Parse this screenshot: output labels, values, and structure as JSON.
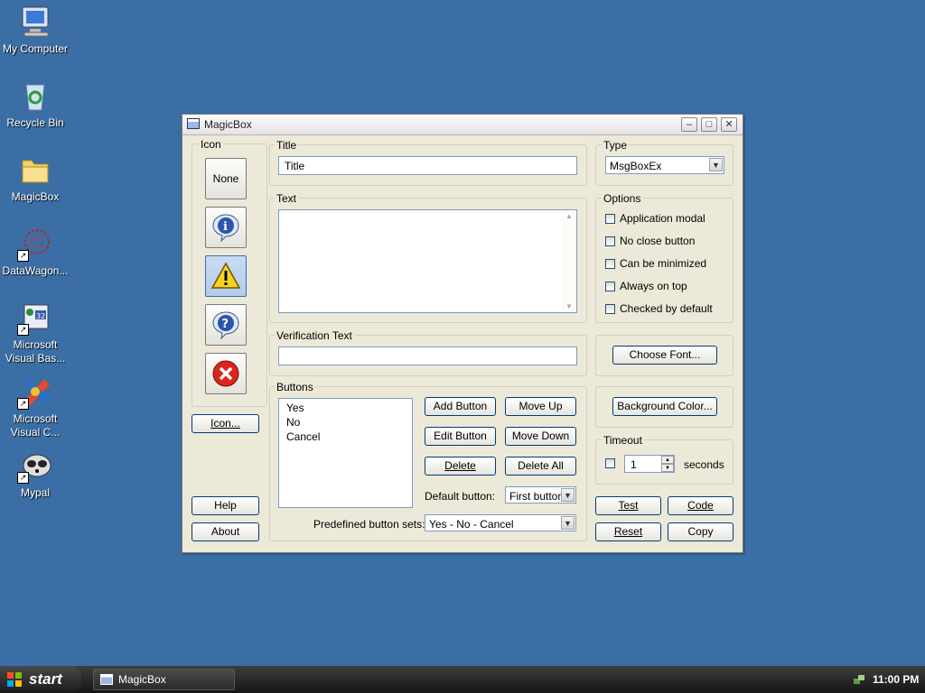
{
  "desktop": {
    "icons": [
      {
        "label": "My Computer",
        "icon": "computer-icon"
      },
      {
        "label": "Recycle Bin",
        "icon": "recycle-bin-icon"
      },
      {
        "label": "MagicBox",
        "icon": "folder-icon"
      },
      {
        "label": "DataWagon...",
        "icon": "datawagon-icon"
      },
      {
        "label": "Microsoft Visual Bas...",
        "icon": "visual-basic-icon"
      },
      {
        "label": "Microsoft Visual C...",
        "icon": "visual-c-icon"
      },
      {
        "label": "Mypal",
        "icon": "mypal-icon"
      }
    ]
  },
  "window": {
    "title": "MagicBox",
    "icon_group": {
      "label": "Icon",
      "none_label": "None",
      "icons": [
        "info-icon",
        "warning-icon",
        "question-icon",
        "error-icon"
      ],
      "selected_index": 2,
      "icon_button": "Icon...",
      "help_button": "Help",
      "about_button": "About"
    },
    "title_group": {
      "label": "Title",
      "value": "Title"
    },
    "text_group": {
      "label": "Text",
      "value": ""
    },
    "verification_group": {
      "label": "Verification Text",
      "value": ""
    },
    "buttons_group": {
      "label": "Buttons",
      "items": [
        "Yes",
        "No",
        "Cancel"
      ],
      "add_button": "Add Button",
      "move_up": "Move Up",
      "edit_button": "Edit Button",
      "move_down": "Move Down",
      "delete": "Delete",
      "delete_all": "Delete All",
      "default_label": "Default button:",
      "default_value": "First button",
      "predefined_label": "Predefined button sets:",
      "predefined_value": "Yes - No - Cancel"
    },
    "type_group": {
      "label": "Type",
      "value": "MsgBoxEx"
    },
    "options_group": {
      "label": "Options",
      "items": [
        {
          "label": "Application modal",
          "checked": false
        },
        {
          "label": "No close button",
          "checked": false
        },
        {
          "label": "Can be minimized",
          "checked": false
        },
        {
          "label": "Always on top",
          "checked": false
        },
        {
          "label": "Checked by default",
          "checked": false
        }
      ]
    },
    "choose_font": "Choose Font...",
    "background_color": "Background Color...",
    "timeout_group": {
      "label": "Timeout",
      "value": "1",
      "unit": "seconds"
    },
    "test": "Test",
    "code": "Code",
    "reset": "Reset",
    "copy": "Copy"
  },
  "taskbar": {
    "start_label": "start",
    "task_item": "MagicBox",
    "clock": "11:00 PM"
  }
}
